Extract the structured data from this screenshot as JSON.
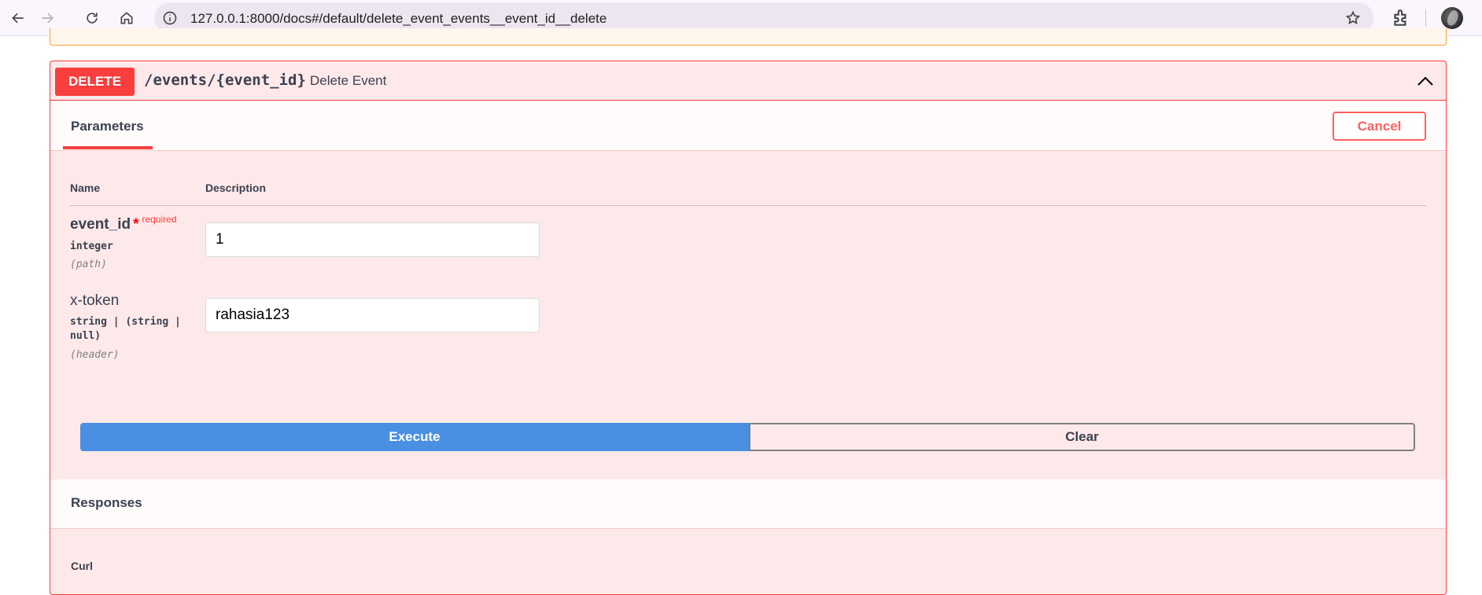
{
  "browser": {
    "url": "127.0.0.1:8000/docs#/default/delete_event_events__event_id__delete",
    "back_icon": "arrow-left-icon",
    "forward_icon": "arrow-right-icon",
    "reload_icon": "reload-icon",
    "home_icon": "home-icon",
    "site_info_icon": "info-icon",
    "bookmark_icon": "star-icon",
    "extensions_icon": "puzzle-icon"
  },
  "operation": {
    "method": "DELETE",
    "path": "/events/{event_id}",
    "summary": "Delete Event",
    "method_color": "#f93e3e",
    "background_color": "#fde9e9"
  },
  "tabs": {
    "parameters": "Parameters",
    "cancel": "Cancel"
  },
  "table": {
    "col_name": "Name",
    "col_description": "Description"
  },
  "parameters": [
    {
      "name": "event_id",
      "required_star": "*",
      "required_label": "required",
      "type": "integer",
      "location": "(path)",
      "value": "1"
    },
    {
      "name": "x-token",
      "type_line1": "string | (string |",
      "type_line2": "null)",
      "location": "(header)",
      "value": "rahasia123"
    }
  ],
  "actions": {
    "execute": "Execute",
    "clear": "Clear",
    "execute_color": "#4990e2"
  },
  "responses": {
    "title": "Responses",
    "curl": "Curl"
  }
}
